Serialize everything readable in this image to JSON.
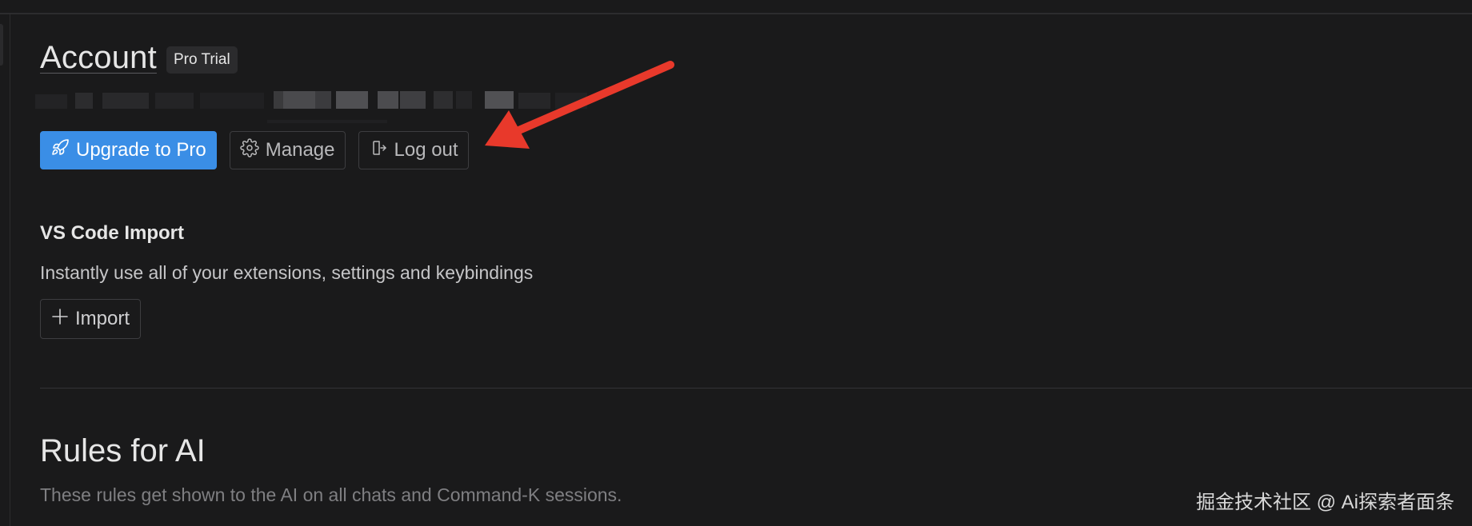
{
  "account": {
    "title": "Account",
    "plan_badge": "Pro Trial",
    "buttons": {
      "upgrade_label": "Upgrade to Pro",
      "manage_label": "Manage",
      "logout_label": "Log out"
    }
  },
  "vscode_import": {
    "title": "VS Code Import",
    "description": "Instantly use all of your extensions, settings and keybindings",
    "import_label": "Import"
  },
  "rules": {
    "title": "Rules for AI",
    "description": "These rules get shown to the AI on all chats and Command-K sessions."
  },
  "watermark": "掘金技术社区 @ Ai探索者面条",
  "colors": {
    "background": "#1a1a1b",
    "primary": "#3a8ee6",
    "annotation_arrow": "#e8392b"
  },
  "icons": {
    "upgrade": "rocket-icon",
    "manage": "gear-icon",
    "logout": "logout-icon",
    "import": "plus-icon"
  }
}
